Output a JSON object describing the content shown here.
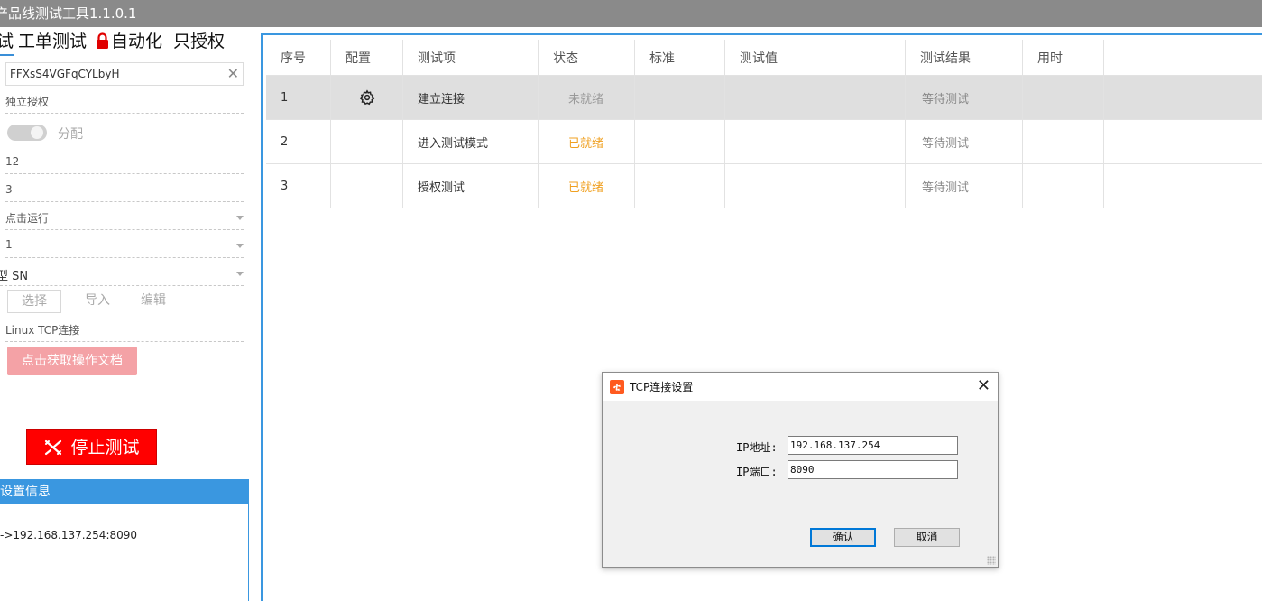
{
  "window": {
    "title": "产品线测试工具1.1.0.1"
  },
  "tabs": [
    {
      "label": "试"
    },
    {
      "label": "工单测试"
    },
    {
      "label": "自动化"
    },
    {
      "label": "只授权"
    }
  ],
  "left": {
    "key_value": "FFXsS4VGFqCYLbyH",
    "auth_mode": "独立授权",
    "toggle_label": "分配",
    "field1": "12",
    "field2": "3",
    "run_mode": "点击运行",
    "select_count": "1",
    "sn_select": "SN",
    "sn_prefix": "型",
    "btn_select": "选择",
    "btn_import": "导入",
    "btn_edit": "编辑",
    "connection": "Linux TCP连接",
    "doc_button": "点击获取操作文档",
    "stop_button": "停止测试",
    "info_header": "设置信息",
    "info_line": "->192.168.137.254:8090"
  },
  "table": {
    "headers": [
      "序号",
      "配置",
      "测试项",
      "状态",
      "标准",
      "测试值",
      "测试结果",
      "用时"
    ],
    "rows": [
      {
        "index": "1",
        "item": "建立连接",
        "status": "未就绪",
        "standard": "",
        "value": "",
        "result": "等待测试",
        "time": ""
      },
      {
        "index": "2",
        "item": "进入测试模式",
        "status": "已就绪",
        "standard": "",
        "value": "",
        "result": "等待测试",
        "time": ""
      },
      {
        "index": "3",
        "item": "授权测试",
        "status": "已就绪",
        "standard": "",
        "value": "",
        "result": "等待测试",
        "time": ""
      }
    ]
  },
  "dialog": {
    "title": "TCP连接设置",
    "ip_label": "IP地址:",
    "ip_value": "192.168.137.254",
    "port_label": "IP端口:",
    "port_value": "8090",
    "ok": "确认",
    "cancel": "取消"
  },
  "colors": {
    "accent": "#3a97e0",
    "stop": "#ff0000",
    "ready": "#f0a020",
    "doc_button": "#f4a2a6"
  }
}
